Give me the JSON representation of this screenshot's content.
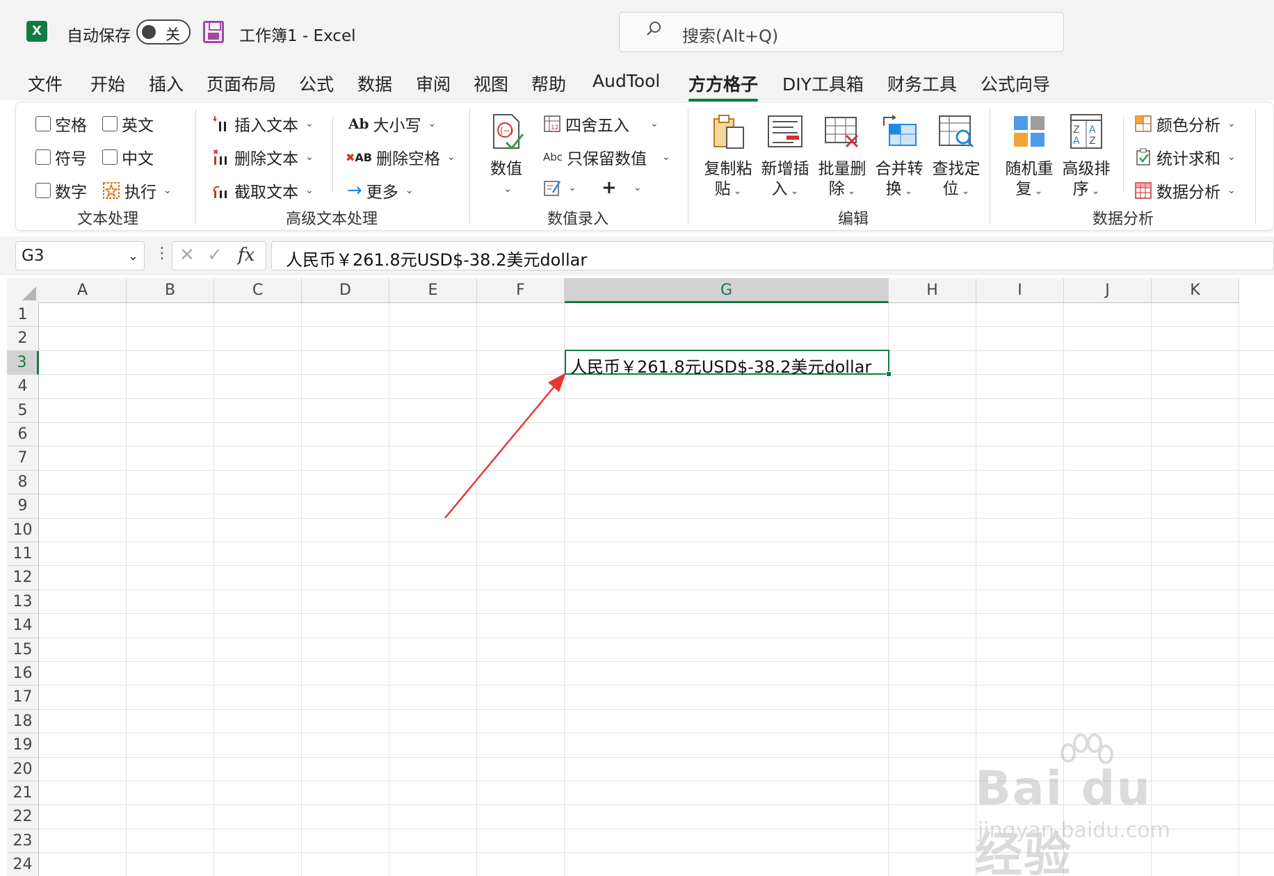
{
  "titlebar": {
    "autosave_label": "自动保存",
    "autosave_state": "关",
    "doc_title": "工作簿1  -  Excel",
    "search_placeholder": "搜索(Alt+Q)",
    "app_logo": "X"
  },
  "tabs": [
    "文件",
    "开始",
    "插入",
    "页面布局",
    "公式",
    "数据",
    "审阅",
    "视图",
    "帮助",
    "AudTool",
    "方方格子",
    "DIY工具箱",
    "财务工具",
    "公式向导"
  ],
  "active_tab": "方方格子",
  "ribbon": {
    "text_processing": {
      "label": "文本处理",
      "items": [
        "空格",
        "英文",
        "符号",
        "中文",
        "数字",
        "执行"
      ]
    },
    "advanced_text": {
      "label": "高级文本处理",
      "items": [
        "插入文本",
        "删除文本",
        "截取文本",
        "大小写",
        "删除空格",
        "更多"
      ]
    },
    "numeric_input": {
      "label": "数值录入",
      "big": "数值",
      "items": [
        "四舍五入",
        "只保留数值"
      ],
      "plus": "+"
    },
    "edit": {
      "label": "编辑",
      "buttons": [
        {
          "l1": "复制粘",
          "l2": "贴"
        },
        {
          "l1": "新增插",
          "l2": "入"
        },
        {
          "l1": "批量删",
          "l2": "除"
        },
        {
          "l1": "合并转",
          "l2": "换"
        },
        {
          "l1": "查找定",
          "l2": "位"
        }
      ]
    },
    "data_analysis": {
      "label": "数据分析",
      "buttons": [
        {
          "l1": "随机重",
          "l2": "复"
        },
        {
          "l1": "高级排",
          "l2": "序"
        }
      ],
      "items": [
        "颜色分析",
        "统计求和",
        "数据分析"
      ]
    }
  },
  "formula_bar": {
    "cell_ref": "G3",
    "fx": "fx",
    "cancel": "✕",
    "confirm": "✓",
    "value": "人民币￥261.8元USD$-38.2美元dollar"
  },
  "grid": {
    "columns": [
      "A",
      "B",
      "C",
      "D",
      "E",
      "F",
      "G",
      "H",
      "I",
      "J",
      "K"
    ],
    "rows": [
      "1",
      "2",
      "3",
      "4",
      "5",
      "6",
      "7",
      "8",
      "9",
      "10",
      "11",
      "12",
      "13",
      "14",
      "15",
      "16",
      "17",
      "18",
      "19",
      "20",
      "21",
      "22",
      "23",
      "24"
    ],
    "selected_column": "G",
    "selected_row": "3",
    "active_cell_value": "人民币￥261.8元USD$-38.2美元dollar"
  },
  "watermark": {
    "main": "Bai du 经验",
    "sub": "jingyan.baidu.com"
  },
  "colors": {
    "accent": "#107c41",
    "annotation_arrow": "#e53935"
  }
}
